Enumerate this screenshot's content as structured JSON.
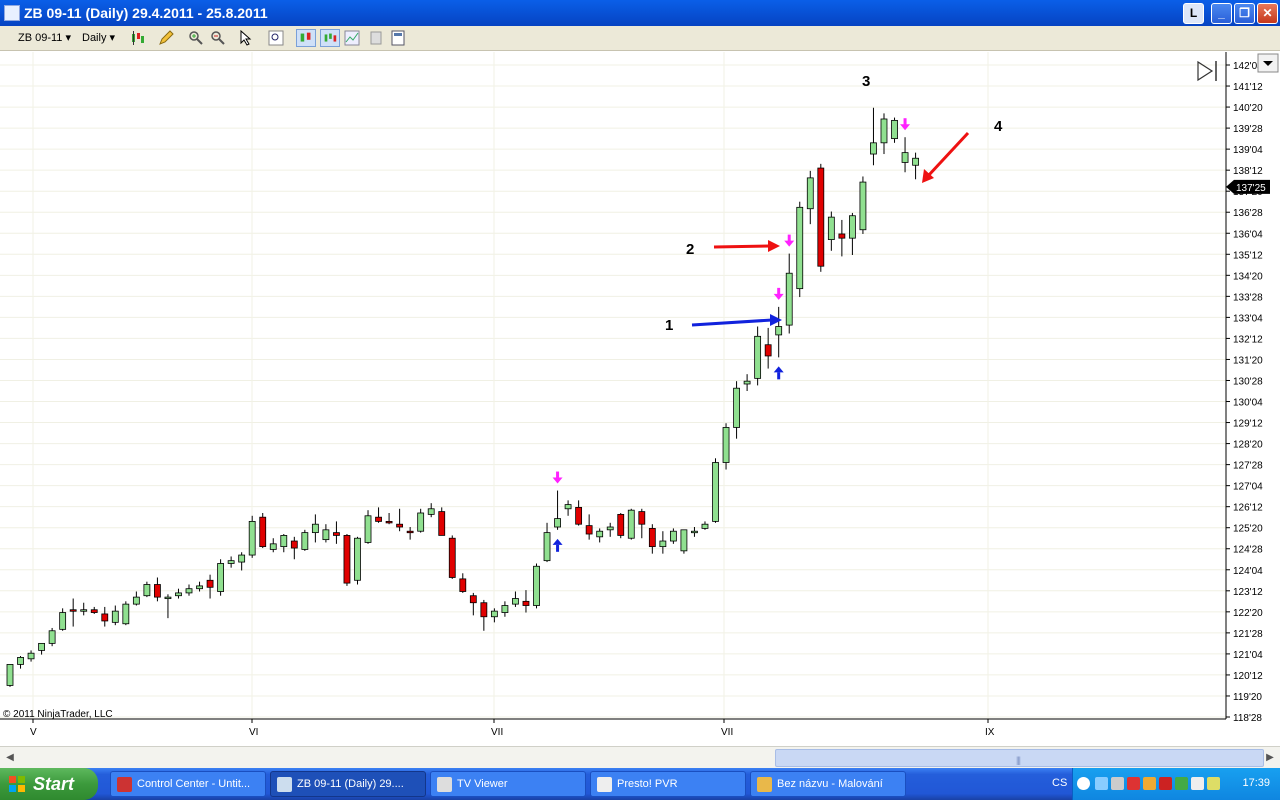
{
  "window": {
    "title": "ZB 09-11 (Daily)  29.4.2011 - 25.8.2011",
    "buttons": [
      "L",
      "_",
      "❐",
      "✕"
    ]
  },
  "toolbar": {
    "instrument": "ZB 09-11",
    "period": "Daily"
  },
  "chart": {
    "copyright": "© 2011 NinjaTrader, LLC",
    "annotations": [
      "1",
      "2",
      "3",
      "4"
    ],
    "last_price": "137'25",
    "y_ticks": [
      "142'04",
      "141'12",
      "140'20",
      "139'28",
      "139'04",
      "138'12",
      "137'20",
      "136'28",
      "136'04",
      "135'12",
      "134'20",
      "133'28",
      "133'04",
      "132'12",
      "131'20",
      "130'28",
      "130'04",
      "129'12",
      "128'20",
      "127'28",
      "127'04",
      "126'12",
      "125'20",
      "124'28",
      "124'04",
      "123'12",
      "122'20",
      "121'28",
      "121'04",
      "120'12",
      "119'20",
      "118'28"
    ],
    "x_ticks": [
      "V",
      "VI",
      "VII",
      "VII",
      "IX"
    ],
    "colors": {
      "up": "#90e090",
      "down": "#e00000",
      "arrow_red": "#ee1111",
      "arrow_blue": "#1122dd",
      "arrow_magenta": "#ff22ff"
    }
  },
  "chart_data": {
    "type": "candlestick",
    "unit": "points (32nds)",
    "ylim": [
      118.75,
      142.3
    ],
    "candles": [
      [
        120.0,
        120.75,
        119.95,
        120.75
      ],
      [
        120.75,
        121.05,
        120.6,
        121.0
      ],
      [
        120.95,
        121.25,
        120.85,
        121.15
      ],
      [
        121.25,
        121.5,
        121.1,
        121.5
      ],
      [
        121.5,
        122.05,
        121.4,
        121.95
      ],
      [
        122.0,
        122.75,
        121.95,
        122.6
      ],
      [
        122.7,
        123.1,
        122.1,
        122.65
      ],
      [
        122.65,
        122.95,
        122.5,
        122.7
      ],
      [
        122.7,
        122.8,
        122.55,
        122.6
      ],
      [
        122.55,
        122.8,
        122.1,
        122.3
      ],
      [
        122.25,
        122.85,
        122.15,
        122.65
      ],
      [
        122.2,
        123.0,
        122.15,
        122.9
      ],
      [
        122.9,
        123.35,
        122.85,
        123.15
      ],
      [
        123.2,
        123.7,
        123.15,
        123.6
      ],
      [
        123.6,
        123.85,
        123.0,
        123.15
      ],
      [
        123.1,
        123.25,
        122.4,
        123.15
      ],
      [
        123.2,
        123.45,
        123.1,
        123.3
      ],
      [
        123.3,
        123.6,
        123.2,
        123.45
      ],
      [
        123.45,
        123.7,
        123.35,
        123.55
      ],
      [
        123.75,
        123.95,
        123.1,
        123.5
      ],
      [
        123.35,
        124.5,
        123.2,
        124.35
      ],
      [
        124.35,
        124.6,
        124.2,
        124.45
      ],
      [
        124.4,
        124.75,
        124.1,
        124.65
      ],
      [
        124.65,
        126.05,
        124.55,
        125.85
      ],
      [
        126.0,
        126.15,
        124.9,
        124.95
      ],
      [
        124.85,
        125.25,
        124.75,
        125.05
      ],
      [
        124.95,
        125.4,
        124.75,
        125.35
      ],
      [
        125.15,
        125.3,
        124.5,
        124.9
      ],
      [
        124.85,
        125.55,
        124.8,
        125.45
      ],
      [
        125.45,
        126.1,
        125.1,
        125.75
      ],
      [
        125.2,
        125.75,
        125.1,
        125.55
      ],
      [
        125.45,
        125.85,
        125.05,
        125.35
      ],
      [
        125.35,
        125.4,
        123.55,
        123.65
      ],
      [
        123.75,
        125.3,
        123.6,
        125.25
      ],
      [
        125.1,
        126.25,
        125.05,
        126.05
      ],
      [
        126.0,
        126.35,
        125.8,
        125.85
      ],
      [
        125.85,
        126.15,
        125.75,
        125.8
      ],
      [
        125.75,
        126.3,
        125.5,
        125.65
      ],
      [
        125.5,
        125.65,
        125.2,
        125.45
      ],
      [
        125.5,
        126.3,
        125.45,
        126.15
      ],
      [
        126.1,
        126.5,
        126.0,
        126.3
      ],
      [
        126.2,
        126.35,
        125.35,
        125.35
      ],
      [
        125.25,
        125.35,
        123.8,
        123.85
      ],
      [
        123.8,
        124.0,
        123.3,
        123.35
      ],
      [
        123.2,
        123.3,
        122.5,
        122.95
      ],
      [
        122.95,
        123.05,
        121.95,
        122.45
      ],
      [
        122.45,
        122.75,
        122.25,
        122.65
      ],
      [
        122.6,
        123.0,
        122.45,
        122.85
      ],
      [
        122.9,
        123.35,
        122.8,
        123.1
      ],
      [
        123.0,
        123.4,
        122.6,
        122.85
      ],
      [
        122.85,
        124.35,
        122.75,
        124.25
      ],
      [
        124.45,
        125.8,
        124.4,
        125.45
      ],
      [
        125.65,
        126.95,
        125.55,
        125.95
      ],
      [
        126.3,
        126.6,
        126.05,
        126.45
      ],
      [
        126.35,
        126.6,
        125.7,
        125.75
      ],
      [
        125.7,
        126.1,
        125.2,
        125.4
      ],
      [
        125.3,
        125.6,
        125.1,
        125.5
      ],
      [
        125.55,
        125.8,
        125.3,
        125.65
      ],
      [
        126.1,
        126.15,
        125.25,
        125.35
      ],
      [
        125.25,
        126.3,
        125.2,
        126.25
      ],
      [
        126.2,
        126.3,
        125.25,
        125.75
      ],
      [
        125.6,
        125.75,
        124.7,
        124.95
      ],
      [
        124.95,
        125.5,
        124.7,
        125.15
      ],
      [
        125.15,
        125.6,
        125.05,
        125.5
      ],
      [
        124.8,
        125.55,
        124.7,
        125.55
      ],
      [
        125.5,
        125.65,
        125.3,
        125.5
      ],
      [
        125.6,
        125.85,
        125.55,
        125.75
      ],
      [
        125.85,
        128.1,
        125.8,
        127.95
      ],
      [
        127.95,
        129.35,
        127.7,
        129.2
      ],
      [
        129.2,
        130.85,
        128.8,
        130.6
      ],
      [
        130.75,
        131.1,
        130.5,
        130.85
      ],
      [
        130.95,
        132.8,
        130.7,
        132.45
      ],
      [
        132.15,
        132.75,
        131.3,
        131.75
      ],
      [
        132.5,
        133.5,
        131.7,
        132.8
      ],
      [
        132.85,
        135.4,
        132.55,
        134.7
      ],
      [
        134.15,
        137.25,
        133.85,
        137.05
      ],
      [
        137.0,
        138.35,
        136.45,
        138.1
      ],
      [
        138.45,
        138.6,
        134.75,
        134.95
      ],
      [
        135.9,
        136.9,
        135.5,
        136.7
      ],
      [
        136.1,
        136.6,
        135.3,
        135.95
      ],
      [
        135.95,
        136.85,
        135.35,
        136.75
      ],
      [
        136.25,
        138.15,
        136.1,
        137.95
      ],
      [
        138.95,
        140.6,
        138.55,
        139.35
      ],
      [
        139.35,
        140.4,
        138.95,
        140.2
      ],
      [
        139.5,
        140.25,
        139.35,
        140.15
      ],
      [
        138.65,
        139.55,
        138.3,
        139.0
      ],
      [
        138.55,
        139.0,
        138.05,
        138.8
      ]
    ],
    "markers": [
      {
        "bar": 52,
        "kind": "magenta-down"
      },
      {
        "bar": 52,
        "kind": "blue-up"
      },
      {
        "bar": 73,
        "kind": "blue-up"
      },
      {
        "bar": 73,
        "kind": "magenta-down"
      },
      {
        "bar": 74,
        "kind": "magenta-down"
      },
      {
        "bar": 85,
        "kind": "magenta-down"
      }
    ]
  }
}
